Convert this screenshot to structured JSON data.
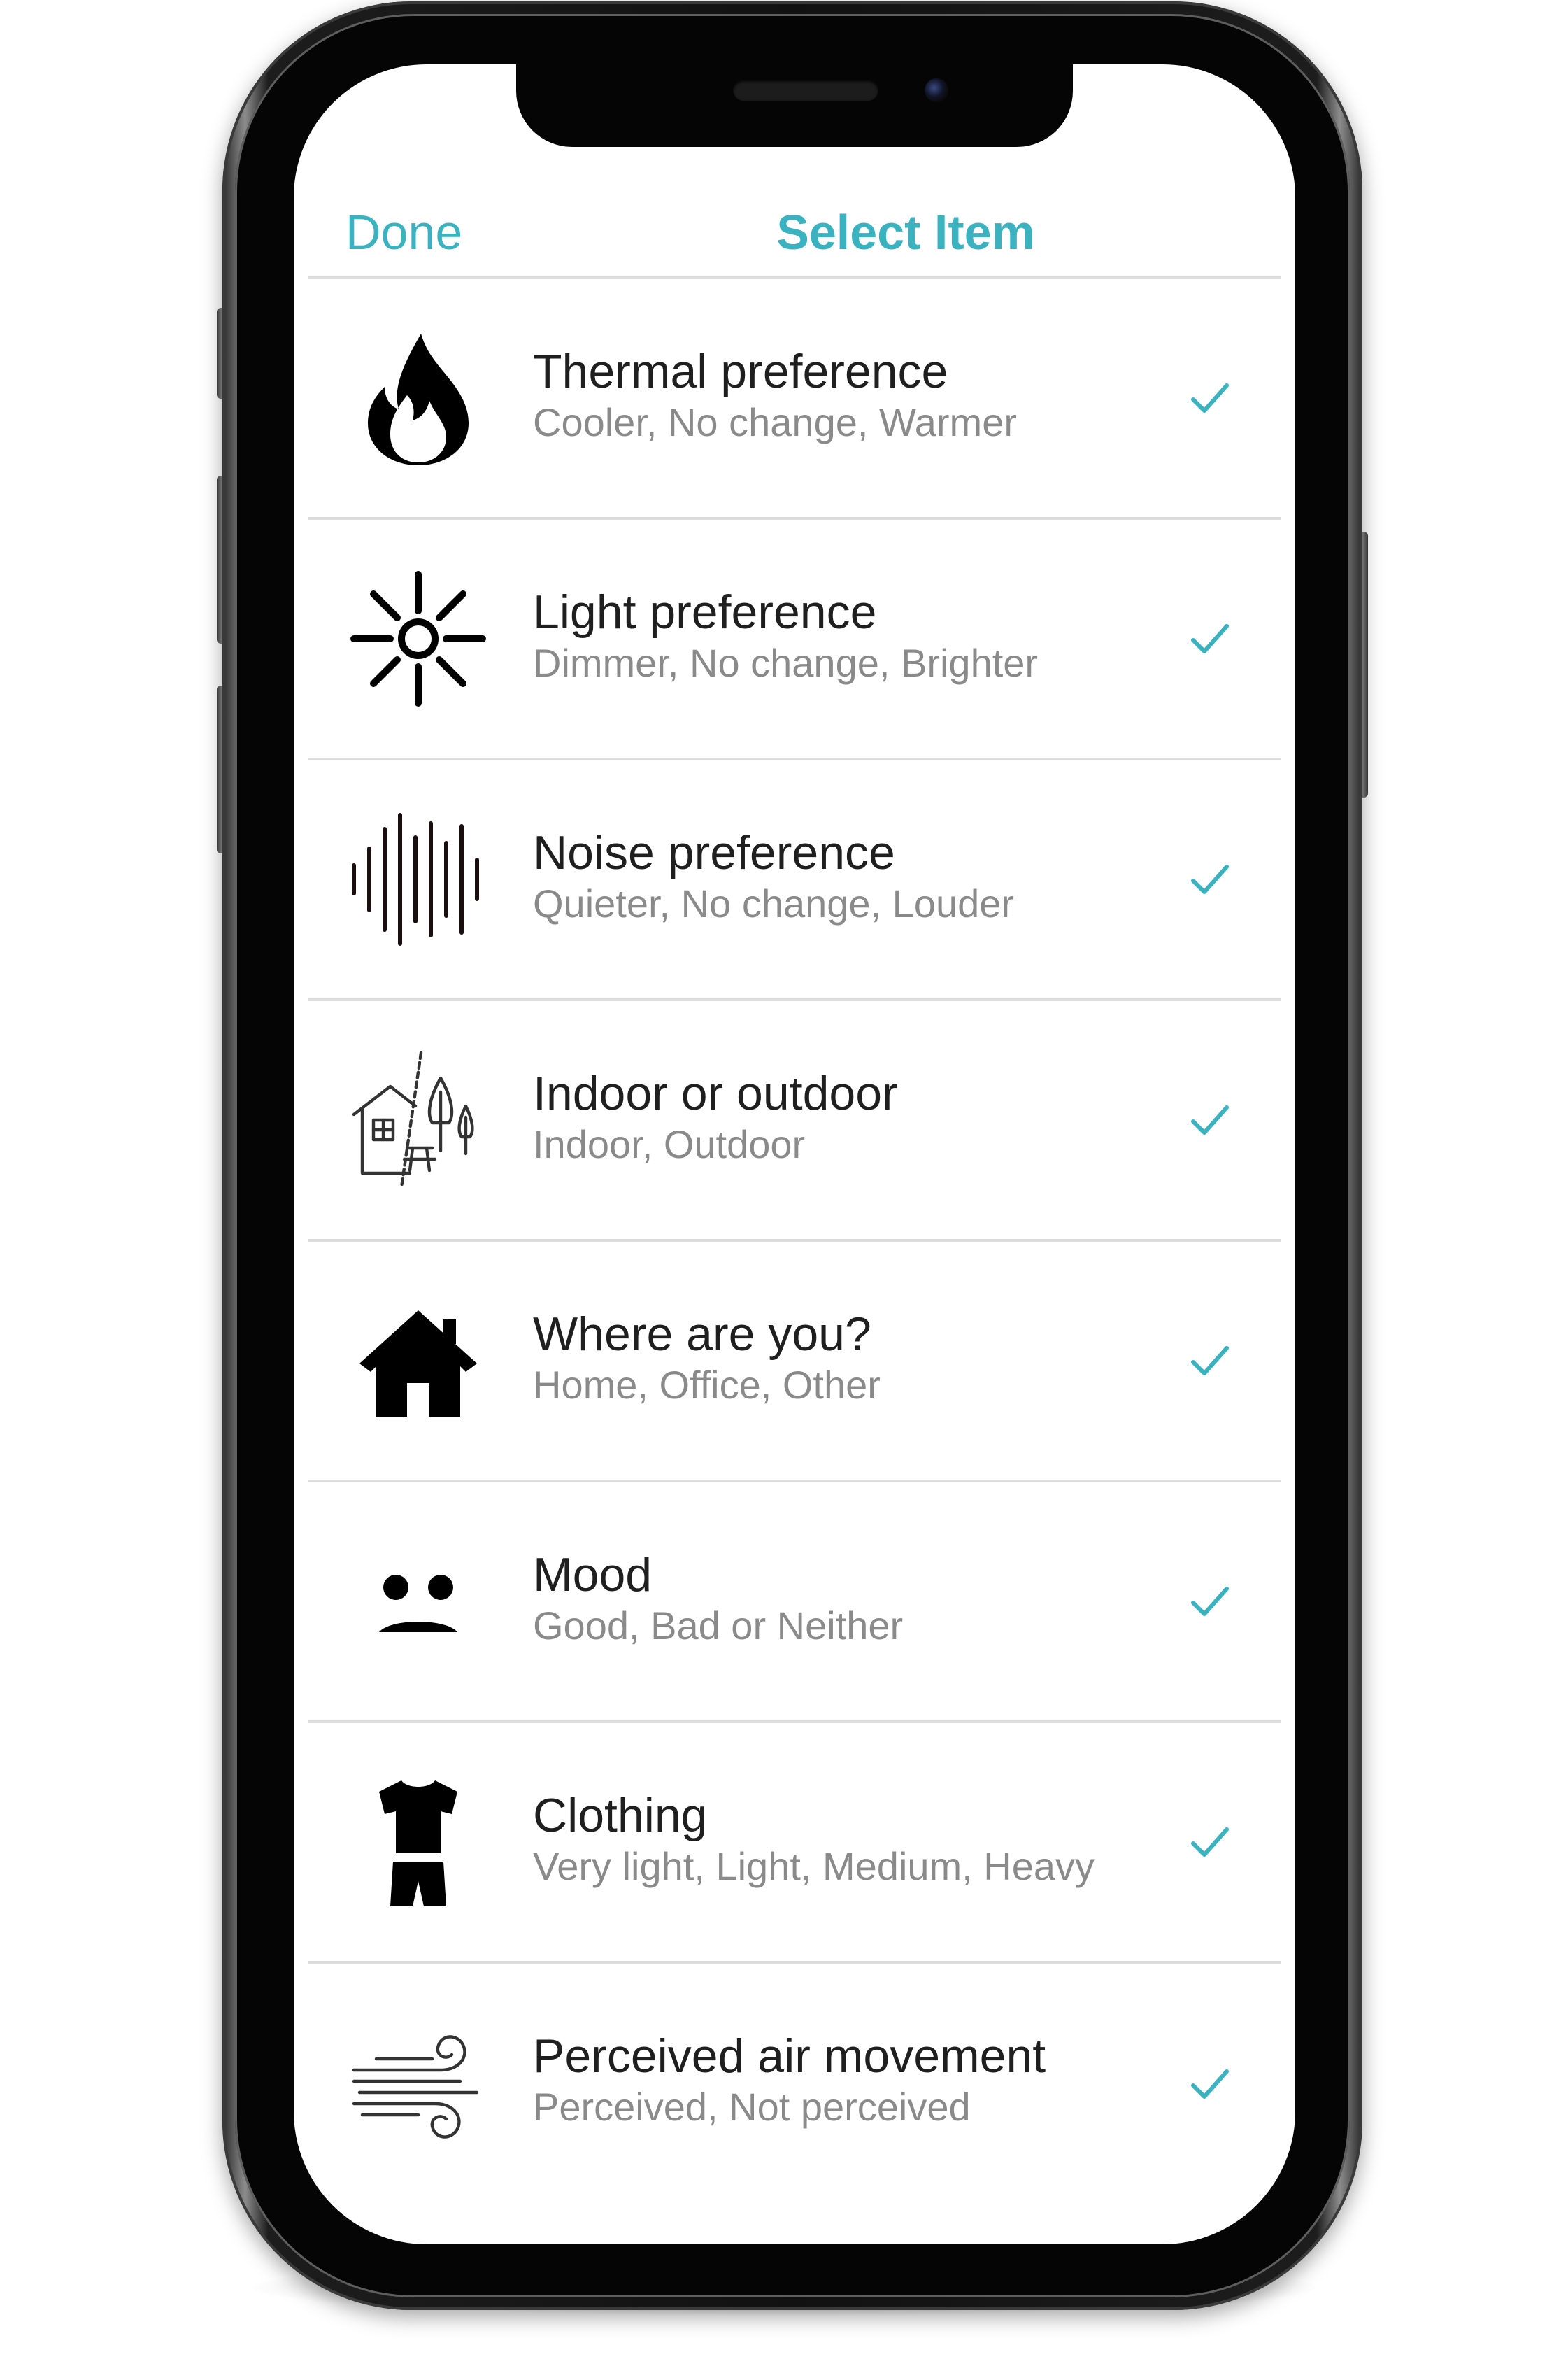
{
  "nav": {
    "done_label": "Done",
    "title": "Select Item"
  },
  "colors": {
    "accent": "#3bb2c0",
    "title_text": "#1f1f1f",
    "subtitle_text": "#8a8a8a",
    "divider": "#dcdcdc"
  },
  "items": [
    {
      "title": "Thermal preference",
      "subtitle": "Cooler, No change, Warmer",
      "icon": "flame-icon",
      "selected": true
    },
    {
      "title": "Light preference",
      "subtitle": "Dimmer, No change, Brighter",
      "icon": "sun-icon",
      "selected": true
    },
    {
      "title": "Noise preference",
      "subtitle": "Quieter, No change, Louder",
      "icon": "sound-wave-icon",
      "selected": true
    },
    {
      "title": "Indoor or outdoor",
      "subtitle": "Indoor, Outdoor",
      "icon": "house-tree-icon",
      "selected": true
    },
    {
      "title": "Where are you?",
      "subtitle": "Home, Office, Other",
      "icon": "home-icon",
      "selected": true
    },
    {
      "title": "Mood",
      "subtitle": "Good, Bad or Neither",
      "icon": "sad-face-icon",
      "selected": true
    },
    {
      "title": "Clothing",
      "subtitle": "Very light, Light, Medium, Heavy",
      "icon": "clothing-icon",
      "selected": true
    },
    {
      "title": "Perceived air movement",
      "subtitle": "Perceived, Not perceived",
      "icon": "wind-icon",
      "selected": true
    }
  ]
}
